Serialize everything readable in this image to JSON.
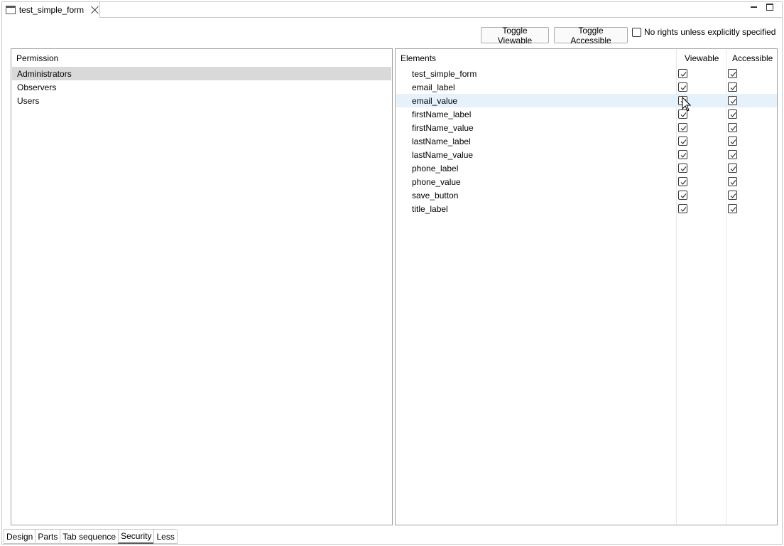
{
  "editor": {
    "tab_label": "test_simple_form",
    "tab_icon": "form-window-icon",
    "close_icon": "close-icon"
  },
  "window_controls": {
    "minimize_icon": "minimize-icon",
    "maximize_icon": "maximize-icon"
  },
  "toolbar": {
    "toggle_viewable_label": "Toggle Viewable",
    "toggle_accessible_label": "Toggle Accessible",
    "no_rights_label": "No rights unless explicitly specified",
    "no_rights_checked": false
  },
  "permissions": {
    "header": "Permission",
    "items": [
      {
        "label": "Administrators",
        "selected": true
      },
      {
        "label": "Observers",
        "selected": false
      },
      {
        "label": "Users",
        "selected": false
      }
    ]
  },
  "elements": {
    "headers": {
      "elements": "Elements",
      "viewable": "Viewable",
      "accessible": "Accessible"
    },
    "rows": [
      {
        "name": "test_simple_form",
        "viewable": true,
        "accessible": true
      },
      {
        "name": "email_label",
        "viewable": true,
        "accessible": true
      },
      {
        "name": "email_value",
        "viewable": true,
        "accessible": true,
        "hover": true
      },
      {
        "name": "firstName_label",
        "viewable": true,
        "accessible": true
      },
      {
        "name": "firstName_value",
        "viewable": true,
        "accessible": true
      },
      {
        "name": "lastName_label",
        "viewable": true,
        "accessible": true
      },
      {
        "name": "lastName_value",
        "viewable": true,
        "accessible": true
      },
      {
        "name": "phone_label",
        "viewable": true,
        "accessible": true
      },
      {
        "name": "phone_value",
        "viewable": true,
        "accessible": true
      },
      {
        "name": "save_button",
        "viewable": true,
        "accessible": true
      },
      {
        "name": "title_label",
        "viewable": true,
        "accessible": true
      }
    ]
  },
  "bottom_tabs": [
    {
      "label": "Design",
      "active": false
    },
    {
      "label": "Parts",
      "active": false
    },
    {
      "label": "Tab sequence",
      "active": false
    },
    {
      "label": "Security",
      "active": true
    },
    {
      "label": "Less",
      "active": false
    }
  ]
}
